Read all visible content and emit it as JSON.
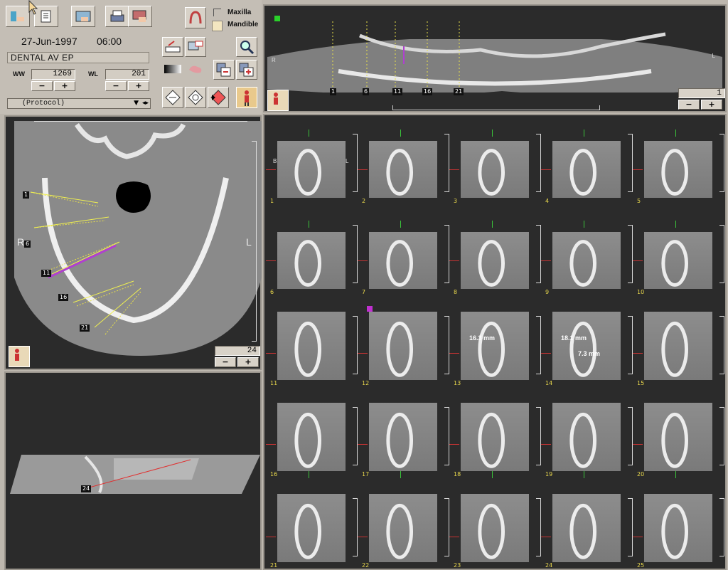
{
  "header": {
    "date": "27-Jun-1997",
    "time": "06:00",
    "study_name": "DENTAL AV EP",
    "ww_label": "WW",
    "ww_value": "1269",
    "wl_label": "WL",
    "wl_value": "201",
    "protocol_placeholder": "(Protocol)",
    "minus": "−",
    "plus": "+"
  },
  "jaw_selector": {
    "maxilla_label": "Maxilla",
    "mandible_label": "Mandible"
  },
  "panoramic_view": {
    "left_label": "R",
    "right_label": "L",
    "slice_markers": [
      "1",
      "6",
      "11",
      "16",
      "21"
    ],
    "counter_value": "1"
  },
  "axial_view": {
    "left_label": "R",
    "right_label": "L",
    "slice_markers": [
      "1",
      "6",
      "11",
      "16",
      "21"
    ],
    "counter_value": "24"
  },
  "sagittal_view": {
    "marker": "24"
  },
  "cross_sections": {
    "side_labels": {
      "buccal": "B",
      "lingual": "L"
    },
    "slices": [
      "1",
      "2",
      "3",
      "4",
      "5",
      "6",
      "7",
      "8",
      "9",
      "10",
      "11",
      "12",
      "13",
      "14",
      "15",
      "16",
      "17",
      "18",
      "19",
      "20",
      "21",
      "22",
      "23",
      "24",
      "25"
    ],
    "measurements": {
      "slice13": "16.3 mm",
      "slice14_a": "18.1 mm",
      "slice14_b": "7.3 mm"
    }
  },
  "colors": {
    "accent_green": "#2ad12a",
    "accent_red": "#e02020",
    "accent_magenta": "#c030d0",
    "marker_yellow": "#e8e04a",
    "background_dark": "#2b2b2b"
  }
}
